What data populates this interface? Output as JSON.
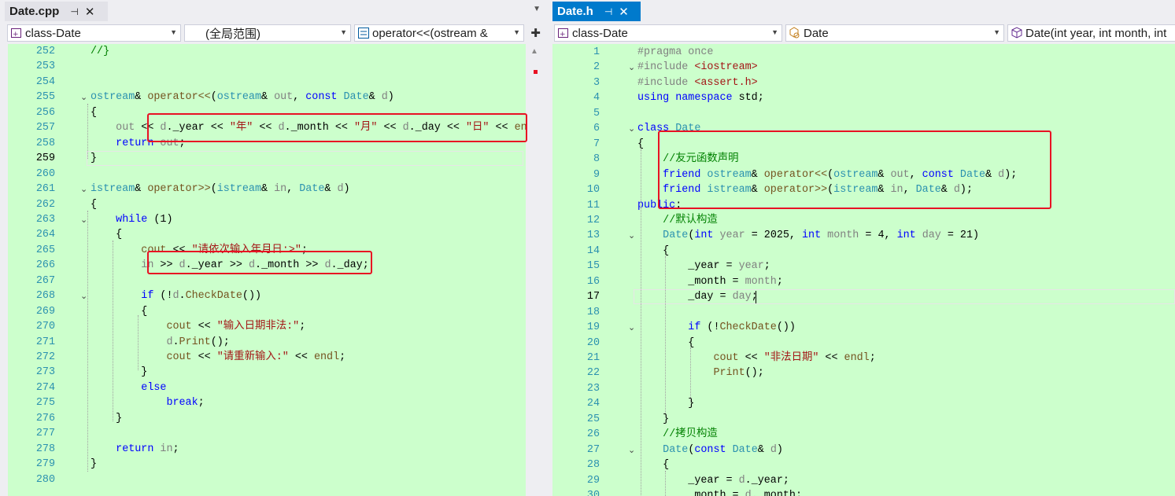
{
  "left": {
    "tab": {
      "title": "Date.cpp",
      "pin": "⊣",
      "close": "✕"
    },
    "nav": {
      "scope_class": "class-Date",
      "scope_global": "(全局范围)",
      "member": "operator<<(ostream &"
    },
    "current_line": 259,
    "lines": [
      {
        "n": 252,
        "html": "<span class='c'>//}</span>"
      },
      {
        "n": 253,
        "html": ""
      },
      {
        "n": 254,
        "html": ""
      },
      {
        "n": 255,
        "fold": true,
        "html": "<span class='t'>ostream</span>&amp; <span class='fn'>operator&lt;&lt;</span>(<span class='t'>ostream</span>&amp; <span class='pm'>out</span>, <span class='k'>const</span> <span class='t'>Date</span>&amp; <span class='pm'>d</span>)"
      },
      {
        "n": 256,
        "html": "{"
      },
      {
        "n": 257,
        "html": "    <span class='pm'>out</span> &lt;&lt; <span class='pm'>d</span>.<span class='m'>_year</span> &lt;&lt; <span class='s'>\"年\"</span> &lt;&lt; <span class='pm'>d</span>.<span class='m'>_month</span> &lt;&lt; <span class='s'>\"月\"</span> &lt;&lt; <span class='pm'>d</span>.<span class='m'>_day</span> &lt;&lt; <span class='s'>\"日\"</span> &lt;&lt; <span class='fn'>en</span>"
      },
      {
        "n": 258,
        "html": "    <span class='k'>return</span> <span class='pm'>out</span>;"
      },
      {
        "n": 259,
        "html": "}"
      },
      {
        "n": 260,
        "html": ""
      },
      {
        "n": 261,
        "fold": true,
        "html": "<span class='t'>istream</span>&amp; <span class='fn'>operator&gt;&gt;</span>(<span class='t'>istream</span>&amp; <span class='pm'>in</span>, <span class='t'>Date</span>&amp; <span class='pm'>d</span>)"
      },
      {
        "n": 262,
        "html": "{"
      },
      {
        "n": 263,
        "fold": true,
        "html": "    <span class='k'>while</span> (1)"
      },
      {
        "n": 264,
        "html": "    {"
      },
      {
        "n": 265,
        "html": "        <span class='fn'>cout</span> &lt;&lt; <span class='s'>\"请依次输入年月日:>\"</span>;"
      },
      {
        "n": 266,
        "html": "        <span class='pm'>in</span> &gt;&gt; <span class='pm'>d</span>.<span class='m'>_year</span> &gt;&gt; <span class='pm'>d</span>.<span class='m'>_month</span> &gt;&gt; <span class='pm'>d</span>.<span class='m'>_day</span>;"
      },
      {
        "n": 267,
        "html": ""
      },
      {
        "n": 268,
        "fold": true,
        "html": "        <span class='k'>if</span> (!<span class='pm'>d</span>.<span class='fn'>CheckDate</span>())"
      },
      {
        "n": 269,
        "html": "        {"
      },
      {
        "n": 270,
        "html": "            <span class='fn'>cout</span> &lt;&lt; <span class='s'>\"输入日期非法:\"</span>;"
      },
      {
        "n": 271,
        "html": "            <span class='pm'>d</span>.<span class='fn'>Print</span>();"
      },
      {
        "n": 272,
        "html": "            <span class='fn'>cout</span> &lt;&lt; <span class='s'>\"请重新输入:\"</span> &lt;&lt; <span class='fn'>endl</span>;"
      },
      {
        "n": 273,
        "html": "        }"
      },
      {
        "n": 274,
        "html": "        <span class='k'>else</span>"
      },
      {
        "n": 275,
        "html": "            <span class='k'>break</span>;"
      },
      {
        "n": 276,
        "html": "    }"
      },
      {
        "n": 277,
        "html": ""
      },
      {
        "n": 278,
        "html": "    <span class='k'>return</span> <span class='pm'>in</span>;"
      },
      {
        "n": 279,
        "html": "}"
      },
      {
        "n": 280,
        "html": ""
      }
    ]
  },
  "right": {
    "tab": {
      "title": "Date.h",
      "pin": "⊣",
      "close": "✕"
    },
    "nav": {
      "scope_class": "class-Date",
      "type": "Date",
      "member": "Date(int year, int month, int"
    },
    "current_line": 17,
    "lines": [
      {
        "n": 1,
        "html": "<span class='p'>#pragma once</span>"
      },
      {
        "n": 2,
        "fold": true,
        "html": "<span class='p'>#include </span><span class='s'>&lt;iostream&gt;</span>"
      },
      {
        "n": 3,
        "html": "<span class='p'>#include </span><span class='s'>&lt;assert.h&gt;</span>"
      },
      {
        "n": 4,
        "html": "<span class='k'>using namespace</span> std;"
      },
      {
        "n": 5,
        "html": ""
      },
      {
        "n": 6,
        "fold": true,
        "html": "<span class='k'>class</span> <span class='t'>Date</span>"
      },
      {
        "n": 7,
        "html": "{"
      },
      {
        "n": 8,
        "html": "    <span class='c'>//友元函数声明</span>"
      },
      {
        "n": 9,
        "html": "    <span class='k'>friend</span> <span class='t'>ostream</span>&amp; <span class='fn'>operator&lt;&lt;</span>(<span class='t'>ostream</span>&amp; <span class='pm'>out</span>, <span class='k'>const</span> <span class='t'>Date</span>&amp; <span class='pm'>d</span>);"
      },
      {
        "n": 10,
        "html": "    <span class='k'>friend</span> <span class='t'>istream</span>&amp; <span class='fn'>operator&gt;&gt;</span>(<span class='t'>istream</span>&amp; <span class='pm'>in</span>, <span class='t'>Date</span>&amp; <span class='pm'>d</span>);"
      },
      {
        "n": 11,
        "html": "<span class='k'>public</span>:"
      },
      {
        "n": 12,
        "html": "    <span class='c'>//默认构造</span>"
      },
      {
        "n": 13,
        "fold": true,
        "html": "    <span class='t'>Date</span>(<span class='k'>int</span> <span class='pm'>year</span> = 2025, <span class='k'>int</span> <span class='pm'>month</span> = 4, <span class='k'>int</span> <span class='pm'>day</span> = 21)"
      },
      {
        "n": 14,
        "html": "    {"
      },
      {
        "n": 15,
        "html": "        <span class='m'>_year</span> = <span class='pm'>year</span>;"
      },
      {
        "n": 16,
        "html": "        <span class='m'>_month</span> = <span class='pm'>month</span>;"
      },
      {
        "n": 17,
        "html": "        <span class='m'>_day</span> = <span class='pm'>day</span>;"
      },
      {
        "n": 18,
        "html": ""
      },
      {
        "n": 19,
        "fold": true,
        "html": "        <span class='k'>if</span> (!<span class='fn'>CheckDate</span>())"
      },
      {
        "n": 20,
        "html": "        {"
      },
      {
        "n": 21,
        "html": "            <span class='fn'>cout</span> &lt;&lt; <span class='s'>\"非法日期\"</span> &lt;&lt; <span class='fn'>endl</span>;"
      },
      {
        "n": 22,
        "html": "            <span class='fn'>Print</span>();"
      },
      {
        "n": 23,
        "html": ""
      },
      {
        "n": 24,
        "html": "        }"
      },
      {
        "n": 25,
        "html": "    }"
      },
      {
        "n": 26,
        "html": "    <span class='c'>//拷贝构造</span>"
      },
      {
        "n": 27,
        "fold": true,
        "html": "    <span class='t'>Date</span>(<span class='k'>const</span> <span class='t'>Date</span>&amp; <span class='pm'>d</span>)"
      },
      {
        "n": 28,
        "html": "    {"
      },
      {
        "n": 29,
        "html": "        <span class='m'>_year</span> = <span class='pm'>d</span>.<span class='m'>_year</span>;"
      },
      {
        "n": 30,
        "html": "        <span class='m'>_month</span> = <span class='pm'>d</span>.<span class='m'>_month</span>;"
      }
    ]
  },
  "colors": {
    "editor_bg": "#ccffcc",
    "accent": "#007acc",
    "highlight": "#e81123"
  }
}
